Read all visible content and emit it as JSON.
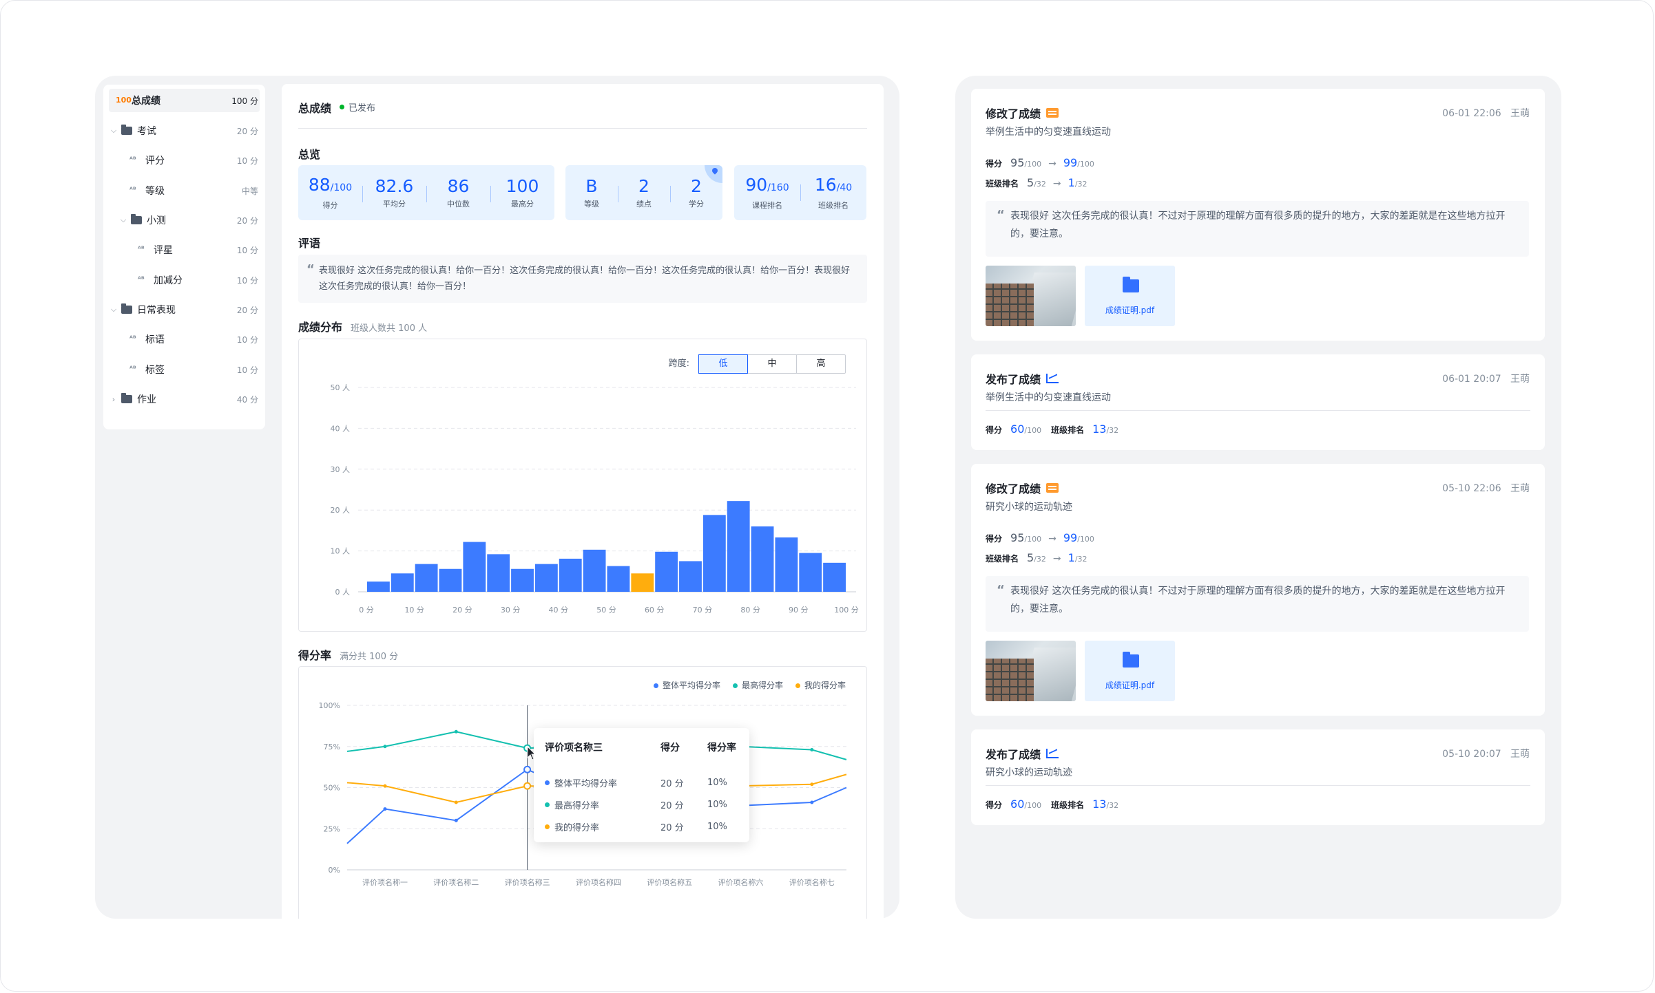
{
  "sidebar": {
    "items": [
      {
        "label": "总成绩",
        "value": "100 分",
        "icon": "score-icon",
        "prefix": "100"
      },
      {
        "label": "考试",
        "value": "20 分",
        "icon": "folder-icon"
      },
      {
        "label": "评分",
        "value": "10 分",
        "icon": "abc-icon"
      },
      {
        "label": "等级",
        "value": "中等",
        "icon": "abc-icon"
      },
      {
        "label": "小测",
        "value": "20 分",
        "icon": "folder-icon"
      },
      {
        "label": "评星",
        "value": "10 分",
        "icon": "abc-icon"
      },
      {
        "label": "加减分",
        "value": "10 分",
        "icon": "abc-icon"
      },
      {
        "label": "日常表现",
        "value": "20 分",
        "icon": "folder-icon"
      },
      {
        "label": "标语",
        "value": "10 分",
        "icon": "abc-icon"
      },
      {
        "label": "标签",
        "value": "10 分",
        "icon": "abc-icon"
      },
      {
        "label": "作业",
        "value": "40 分",
        "icon": "folder-icon"
      }
    ]
  },
  "main": {
    "title": "总成绩",
    "status": "已发布",
    "overview_title": "总览",
    "stats_a": [
      {
        "num": "88",
        "unit": "/100",
        "label": "得分"
      },
      {
        "num": "82.6",
        "unit": "",
        "label": "平均分"
      },
      {
        "num": "86",
        "unit": "",
        "label": "中位数"
      },
      {
        "num": "100",
        "unit": "",
        "label": "最高分"
      }
    ],
    "stats_b": [
      {
        "num": "B",
        "unit": "",
        "label": "等级"
      },
      {
        "num": "2",
        "unit": "",
        "label": "绩点"
      },
      {
        "num": "2",
        "unit": "",
        "label": "学分"
      }
    ],
    "stats_c": [
      {
        "num": "90",
        "unit": "/160",
        "label": "课程排名"
      },
      {
        "num": "16",
        "unit": "/40",
        "label": "班级排名"
      }
    ],
    "comment_title": "评语",
    "comment_text": "表现很好 这次任务完成的很认真！给你一百分！这次任务完成的很认真！给你一百分！这次任务完成的很认真！给你一百分！表现很好 这次任务完成的很认真！给你一百分！",
    "dist_title": "成绩分布",
    "dist_sub": "班级人数共 100 人",
    "span_label": "跨度:",
    "span_options": [
      "低",
      "中",
      "高"
    ],
    "span_selected": "低",
    "rate_title": "得分率",
    "rate_sub": "满分共 100 分"
  },
  "chart_data": [
    {
      "type": "bar",
      "yticks": [
        "0 人",
        "10 人",
        "20 人",
        "30 人",
        "40 人",
        "50 人"
      ],
      "ylim": [
        0,
        50
      ],
      "xticks": [
        "0 分",
        "10 分",
        "20 分",
        "30 分",
        "40 分",
        "50 分",
        "60 分",
        "70 分",
        "80 分",
        "90 分",
        "100 分"
      ],
      "values": [
        2.5,
        4.5,
        6.8,
        5.6,
        12.2,
        9.2,
        5.6,
        6.8,
        8.1,
        10.3,
        6.3,
        4.5,
        9.8,
        7.5,
        18.8,
        22.2,
        16,
        13.3,
        9.5,
        7.1
      ],
      "highlight_index": 11,
      "bar_color": "#3c7bff",
      "highlight_color": "#ffad0d"
    },
    {
      "type": "line",
      "ylim": [
        0,
        100
      ],
      "yticks": [
        "0%",
        "25%",
        "50%",
        "75%",
        "100%"
      ],
      "categories": [
        "评价项名称一",
        "评价项名称二",
        "评价项名称三",
        "评价项名称四",
        "评价项名称五",
        "评价项名称六",
        "评价项名称七"
      ],
      "series": [
        {
          "name": "整体平均得分率",
          "color": "#3c7bff",
          "values": [
            37,
            30,
            61,
            42,
            35,
            39,
            41
          ],
          "start": 16,
          "end": 50
        },
        {
          "name": "最高得分率",
          "color": "#14c0b0",
          "values": [
            75,
            84,
            74,
            75,
            76,
            75,
            73
          ],
          "start": 72,
          "end": 67
        },
        {
          "name": "我的得分率",
          "color": "#ffad0d",
          "values": [
            51,
            41,
            51,
            50,
            50,
            51,
            52
          ],
          "start": 53,
          "end": 58
        }
      ],
      "tooltip": {
        "title": "评价项名称三",
        "col_score": "得分",
        "col_rate": "得分率",
        "rows": [
          {
            "name": "整体平均得分率",
            "score": "20 分",
            "rate": "10%",
            "color": "#3c7bff"
          },
          {
            "name": "最高得分率",
            "score": "20 分",
            "rate": "10%",
            "color": "#14c0b0"
          },
          {
            "name": "我的得分率",
            "score": "20 分",
            "rate": "10%",
            "color": "#ffad0d"
          }
        ]
      }
    }
  ],
  "feed": [
    {
      "title": "修改了成绩",
      "time": "06-01 22:06",
      "author": "王萌",
      "subtitle": "举例生活中的匀变速直线运动",
      "score_old": "95",
      "score_old_total": "/100",
      "score_new": "99",
      "score_new_total": "/100",
      "rank_old": "5",
      "rank_old_total": "/32",
      "rank_new": "1",
      "rank_new_total": "/32",
      "quote": "表现很好 这次任务完成的很认真！不过对于原理的理解方面有很多质的提升的地方，大家的差距就是在这些地方拉开的，要注意。",
      "file": "成绩证明.pdf"
    },
    {
      "title": "发布了成绩",
      "time": "06-01 20:07",
      "author": "王萌",
      "subtitle": "举例生活中的匀变速直线运动",
      "score": "60",
      "score_total": "/100",
      "rank": "13",
      "rank_total": "/32"
    },
    {
      "title": "修改了成绩",
      "time": "05-10 22:06",
      "author": "王萌",
      "subtitle": "研究小球的运动轨迹",
      "score_old": "95",
      "score_old_total": "/100",
      "score_new": "99",
      "score_new_total": "/100",
      "rank_old": "5",
      "rank_old_total": "/32",
      "rank_new": "1",
      "rank_new_total": "/32",
      "quote": "表现很好 这次任务完成的很认真！不过对于原理的理解方面有很多质的提升的地方，大家的差距就是在这些地方拉开的，要注意。",
      "file": "成绩证明.pdf"
    },
    {
      "title": "发布了成绩",
      "time": "05-10 20:07",
      "author": "王萌",
      "subtitle": "研究小球的运动轨迹",
      "score": "60",
      "score_total": "/100",
      "rank": "13",
      "rank_total": "/32"
    }
  ],
  "labels": {
    "score": "得分",
    "class_rank": "班级排名"
  }
}
